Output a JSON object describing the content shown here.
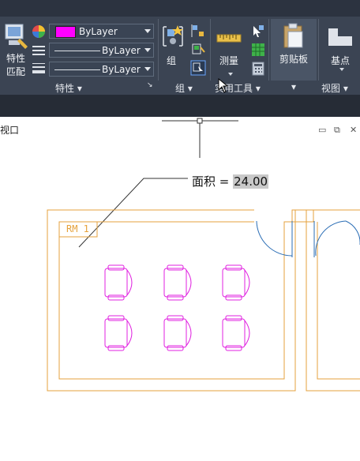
{
  "ribbon": {
    "properties": {
      "match_label_line1": "特性",
      "match_label_line2": "匹配",
      "color_combo": "ByLayer",
      "linetype_combo": "ByLayer",
      "lineweight_combo": "ByLayer",
      "panel_title": "特性"
    },
    "groups": {
      "group_label": "组",
      "panel_title": "组"
    },
    "utilities": {
      "measure_label": "测量",
      "panel_title": "实用工具"
    },
    "clipboard": {
      "label": "剪贴板"
    },
    "view": {
      "basepoint_label": "基点",
      "panel_title": "视图"
    }
  },
  "drawing": {
    "viewport_title": "视口",
    "area_label": "面积 = ",
    "area_value": "24.00",
    "room_tag": "RM 1"
  },
  "colors": {
    "ribbon_bg": "#3b4453",
    "wall_orange": "#e6a23c",
    "chair_magenta": "#e020e0",
    "door_blue": "#2a6db5",
    "color_swatch": "#ff00ff"
  }
}
